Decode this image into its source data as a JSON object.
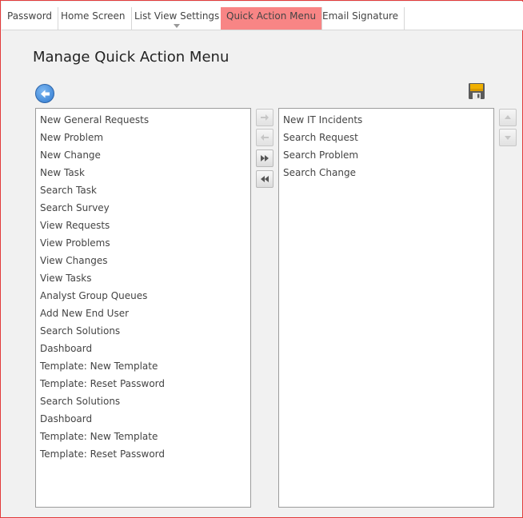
{
  "tabs": [
    {
      "label": "Password"
    },
    {
      "label": "Home Screen"
    },
    {
      "label": "List View Settings"
    },
    {
      "label": "Quick Action Menu"
    },
    {
      "label": "Email Signature"
    }
  ],
  "page_title": "Manage Quick Action Menu",
  "icons": {
    "back": "back-arrow-icon",
    "save": "floppy-disk-icon",
    "move_right": "arrow-right-icon",
    "move_left": "arrow-left-icon",
    "move_all_right": "double-chevron-right-icon",
    "move_all_left": "double-chevron-left-icon",
    "move_up": "triangle-up-icon",
    "move_down": "triangle-down-icon"
  },
  "colors": {
    "active_tab": "#f88585",
    "frame_border": "#e23b3b",
    "back_button": "#2f79cf"
  },
  "available_items": [
    "New General Requests",
    "New Problem",
    "New Change",
    "New Task",
    "Search Task",
    "Search Survey",
    "View Requests",
    "View Problems",
    "View Changes",
    "View Tasks",
    "Analyst Group Queues",
    "Add New End User",
    "Search Solutions",
    "Dashboard",
    "Template: New Template",
    "Template: Reset Password",
    "Search Solutions",
    "Dashboard",
    "Template: New Template",
    "Template: Reset Password"
  ],
  "selected_items": [
    "New IT Incidents",
    "Search Request",
    "Search Problem",
    "Search Change"
  ]
}
